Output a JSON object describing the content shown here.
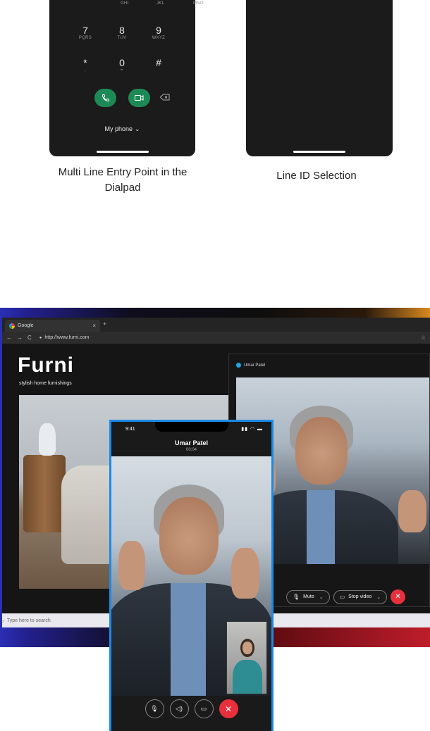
{
  "dialpad": {
    "row_partial": [
      {
        "letters": "GHI"
      },
      {
        "letters": "JKL"
      },
      {
        "letters": "MNO"
      }
    ],
    "row_789": [
      {
        "digit": "7",
        "letters": "PQRS"
      },
      {
        "digit": "8",
        "letters": "TUV"
      },
      {
        "digit": "9",
        "letters": "WXYZ"
      }
    ],
    "row_0": [
      {
        "digit": "*",
        "letters": ","
      },
      {
        "digit": "0",
        "letters": "+"
      },
      {
        "digit": "#",
        "letters": ""
      }
    ],
    "line_selector": "My phone"
  },
  "captions": {
    "left": "Multi Line Entry Point in the Dialpad",
    "right": "Line ID Selection"
  },
  "browser": {
    "tab_title": "Google",
    "url": "http://www.furni.com",
    "site_logo": "Furni",
    "site_tagline": "stylish home furnishings",
    "taskbar_search": "Type here to search"
  },
  "webex": {
    "caller": "Umar Patel",
    "mute_label": "Mute",
    "stop_video_label": "Stop video"
  },
  "mobile": {
    "time": "9:41",
    "caller": "Umar Patel",
    "duration": "00:04"
  },
  "colors": {
    "call_green": "#1d8a55",
    "end_red": "#e8303c",
    "phone_frame_blue": "#1a8ae8"
  }
}
